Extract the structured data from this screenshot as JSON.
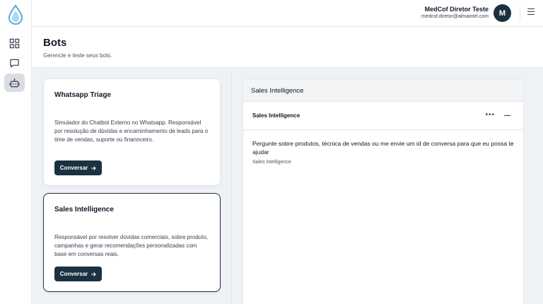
{
  "colors": {
    "primary": "#1c3140",
    "logo": "#5fb3d9"
  },
  "nav": {
    "items": [
      {
        "icon": "dashboard-icon"
      },
      {
        "icon": "chat-icon"
      },
      {
        "icon": "bot-icon",
        "active": true
      }
    ]
  },
  "user": {
    "name": "MedCof Diretor Teste",
    "email": "medcof.diretor@almaintel.com",
    "initial": "M"
  },
  "page": {
    "title": "Bots",
    "subtitle": "Gerencie e teste seus bots."
  },
  "bots": [
    {
      "title": "Whatsapp Triage",
      "description": "Simulador do Chatbot Externo no Whatsapp. Responsável por resolução de dúvidas e encaminhamento de leads para o time de vendas, suporte ou finannceiro.",
      "button_label": "Conversar",
      "selected": false
    },
    {
      "title": "Sales Intelligence",
      "description": "Responsável por resolver dúvidas comerciais, sobre produto, campanhas e gerar recomendações personalizadas com base em conversas reais.",
      "button_label": "Conversar",
      "selected": true
    }
  ],
  "chat": {
    "panel_title": "Sales Intelligence",
    "conversation_title": "Sales Intelligence",
    "message": "Pergunte sobre produtos, técnica de vendas ou me envie um id de conversa para que eu possa te ajudar",
    "sender": "Sales Intelligence"
  }
}
